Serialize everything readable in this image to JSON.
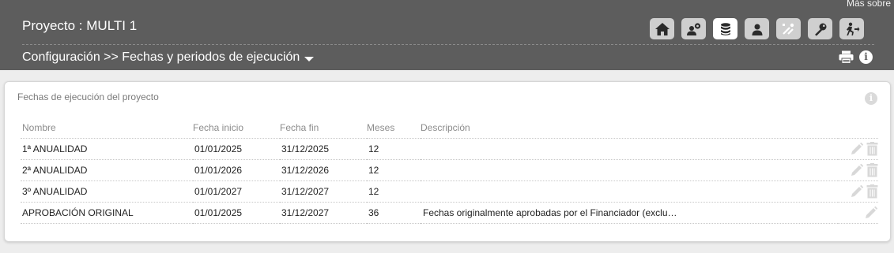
{
  "header": {
    "more_link": "Más sobre",
    "project_title": "Proyecto : MULTI 1",
    "breadcrumb": "Configuración >> Fechas y periodos de ejecución",
    "toolbar": [
      {
        "icon": "home-icon"
      },
      {
        "icon": "user-settings-icon"
      },
      {
        "icon": "database-icon",
        "active": true
      },
      {
        "icon": "user-icon"
      },
      {
        "icon": "tools-icon"
      },
      {
        "icon": "key-icon"
      },
      {
        "icon": "exit-icon"
      }
    ]
  },
  "panel": {
    "title": "Fechas de ejecución del proyecto",
    "columns": [
      "Nombre",
      "Fecha inicio",
      "Fecha fin",
      "Meses",
      "Descripción"
    ],
    "rows": [
      {
        "nombre": "1ª ANUALIDAD",
        "inicio": "01/01/2025",
        "fin": "31/12/2025",
        "meses": "12",
        "descripcion": "",
        "deletable": true
      },
      {
        "nombre": "2ª ANUALIDAD",
        "inicio": "01/01/2026",
        "fin": "31/12/2026",
        "meses": "12",
        "descripcion": "",
        "deletable": true
      },
      {
        "nombre": "3º ANUALIDAD",
        "inicio": "01/01/2027",
        "fin": "31/12/2027",
        "meses": "12",
        "descripcion": "",
        "deletable": true
      },
      {
        "nombre": "APROBACIÓN ORIGINAL",
        "inicio": "01/01/2025",
        "fin": "31/12/2027",
        "meses": "36",
        "descripcion": "Fechas originalmente aprobadas por el Financiador (exclu…",
        "deletable": false
      }
    ]
  },
  "colors": {
    "header_bg": "#5d5d5d",
    "button_bg": "#cfcfcf",
    "button_active_bg": "#ffffff",
    "icon_dark": "#2b2b2b",
    "action_icon": "#d8d8d8"
  }
}
